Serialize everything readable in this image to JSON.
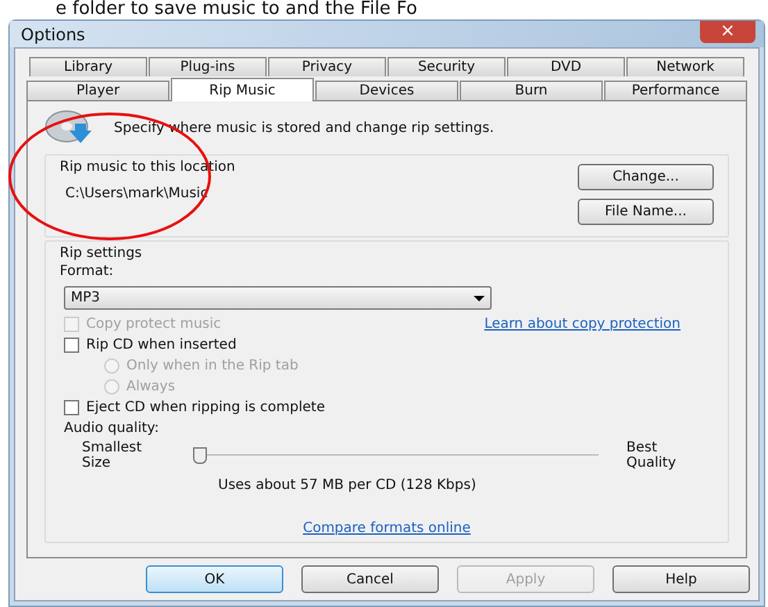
{
  "caption": "e folder to save music to and the File Fo",
  "window": {
    "title": "Options",
    "close": "×"
  },
  "tabs": [
    [
      {
        "label": "Library",
        "selected": false
      },
      {
        "label": "Plug-ins",
        "selected": false
      },
      {
        "label": "Privacy",
        "selected": false
      },
      {
        "label": "Security",
        "selected": false
      },
      {
        "label": "DVD",
        "selected": false
      },
      {
        "label": "Network",
        "selected": false
      }
    ],
    [
      {
        "label": "Player",
        "selected": false
      },
      {
        "label": "Rip Music",
        "selected": true
      },
      {
        "label": "Devices",
        "selected": false
      },
      {
        "label": "Burn",
        "selected": false
      },
      {
        "label": "Performance",
        "selected": false
      }
    ]
  ],
  "description": "Specify where music is stored and change rip settings.",
  "location": {
    "title": "Rip music to this location",
    "path": "C:\\Users\\mark\\Music",
    "buttons": [
      "Change...",
      "File Name..."
    ]
  },
  "rip_settings": {
    "title": "Rip settings",
    "format_label": "Format:",
    "format": "MP3",
    "options": [
      {
        "kind": "checkbox",
        "label": "Copy protect music",
        "checked": false,
        "disabled": true
      },
      {
        "kind": "checkbox",
        "label": "Rip CD when inserted",
        "checked": false,
        "disabled": false
      },
      {
        "kind": "radio",
        "label": "Only when in the Rip tab",
        "checked": false,
        "disabled": true
      },
      {
        "kind": "radio",
        "label": "Always",
        "checked": false,
        "disabled": true
      },
      {
        "kind": "checkbox",
        "label": "Eject CD when ripping is complete",
        "checked": false,
        "disabled": false
      }
    ],
    "copy_protection_link": "Learn about copy protection",
    "audio_quality_label": "Audio quality:",
    "slider": {
      "left_label": "Smallest Size",
      "right_label": "Best Quality",
      "level": 0
    },
    "usage": "Uses about 57 MB per CD (128 Kbps)",
    "compare_link": "Compare formats online"
  },
  "buttons": [
    {
      "label": "OK",
      "default": true,
      "disabled": false
    },
    {
      "label": "Cancel",
      "default": false,
      "disabled": false
    },
    {
      "label": "Apply",
      "default": false,
      "disabled": true
    },
    {
      "label": "Help",
      "default": false,
      "disabled": false
    }
  ]
}
